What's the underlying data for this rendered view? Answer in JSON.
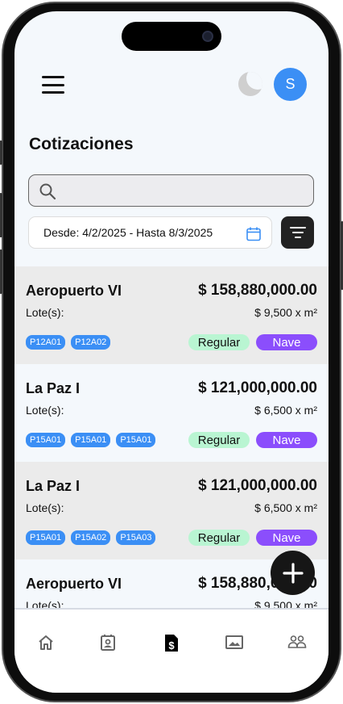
{
  "header": {
    "avatar_letter": "S"
  },
  "page_title": "Cotizaciones",
  "search": {
    "placeholder": ""
  },
  "date_range": "Desde: 4/2/2025 - Hasta 8/3/2025",
  "colors": {
    "accent": "#3b8ff5",
    "regular": "#b9f5d2",
    "nave": "#8b4efc"
  },
  "quotes": [
    {
      "name": "Aeropuerto VI",
      "total": "$ 158,880,000.00",
      "lotes_label": "Lote(s):",
      "price_m2": "$ 9,500 x m²",
      "lots": [
        "P12A01",
        "P12A02"
      ],
      "tag1": "Regular",
      "tag2": "Nave"
    },
    {
      "name": "La Paz I",
      "total": "$ 121,000,000.00",
      "lotes_label": "Lote(s):",
      "price_m2": "$ 6,500 x m²",
      "lots": [
        "P15A01",
        "P15A01",
        "P15A01"
      ],
      "tag1": "Regular",
      "tag2": "Nave"
    },
    {
      "name": "La Paz I",
      "total": "$ 121,000,000.00",
      "lotes_label": "Lote(s):",
      "price_m2": "$ 6,500 x m²",
      "lots": [
        "P15A01",
        "P15A02",
        "P15A03"
      ],
      "tag1": "Regular",
      "tag2": "Nave"
    },
    {
      "name": "Aeropuerto VI",
      "total": "$ 158,880,000.00",
      "lotes_label": "Lote(s):",
      "price_m2": "$ 9,500 x m²",
      "lots": [],
      "tag1": "",
      "tag2": ""
    }
  ],
  "nav": [
    "home-icon",
    "contact-icon",
    "invoice-icon",
    "gallery-icon",
    "users-icon"
  ],
  "nav_active": "invoice-icon"
}
